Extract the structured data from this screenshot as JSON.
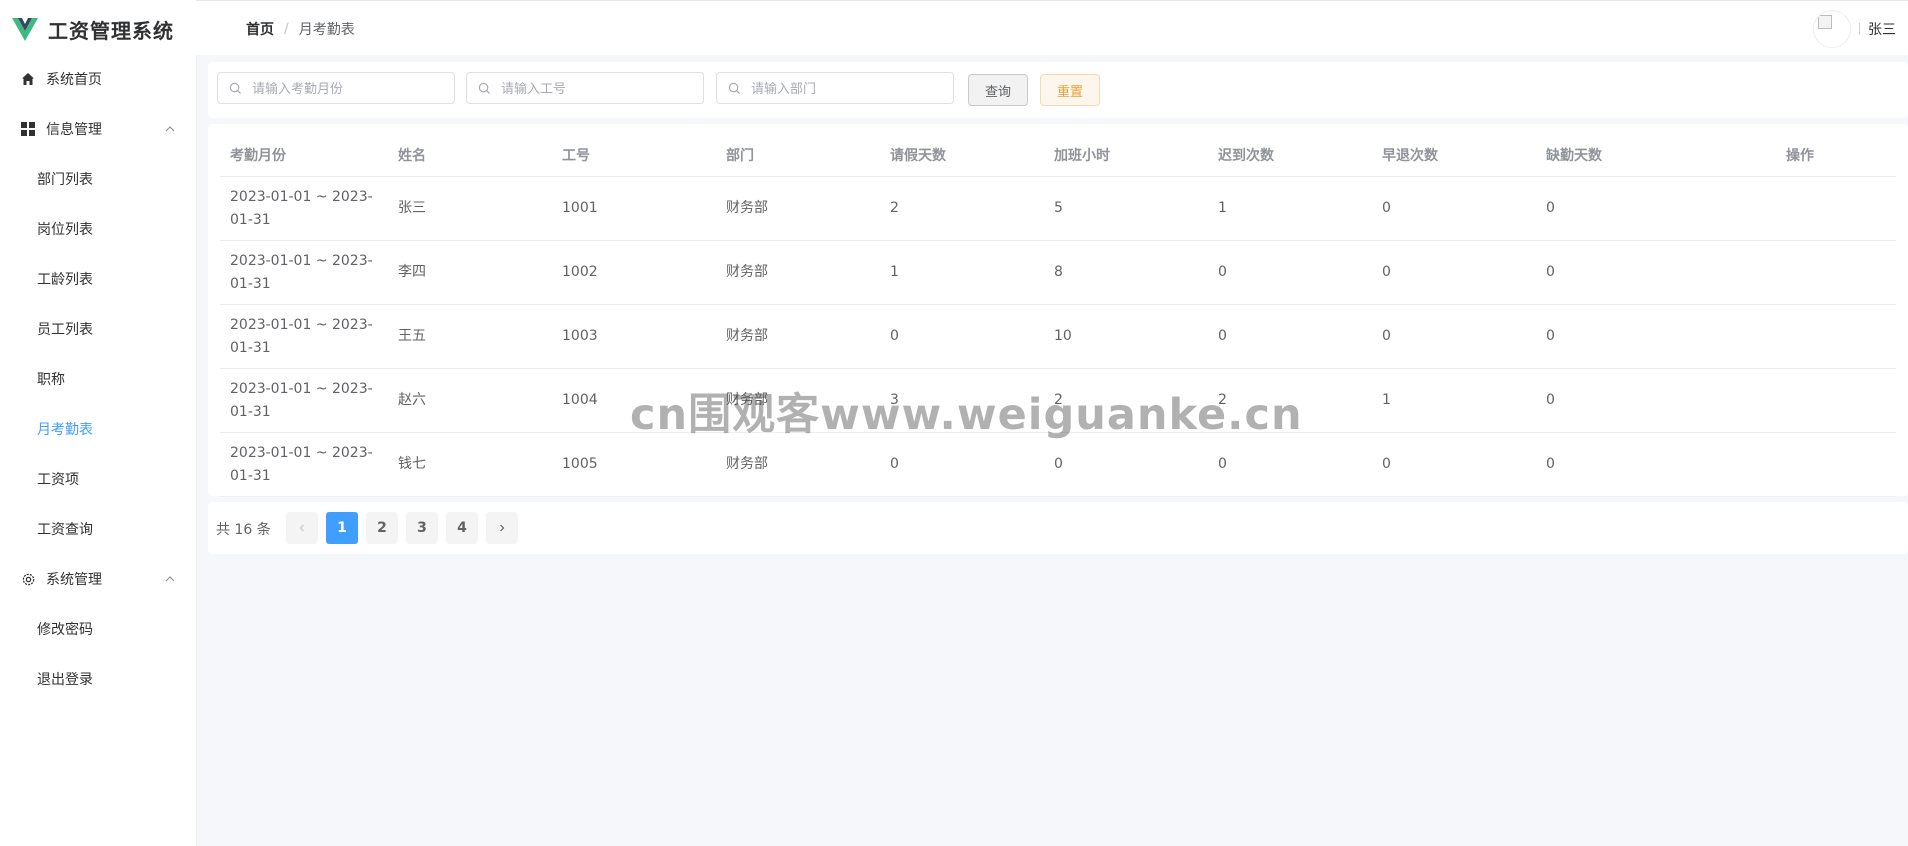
{
  "app": {
    "title": "工资管理系统",
    "brand_color": "#409eff",
    "logo_colors": [
      "#41b883",
      "#35495e"
    ]
  },
  "sidebar": {
    "items": [
      {
        "label": "系统首页",
        "icon": "home-icon"
      },
      {
        "label": "信息管理",
        "icon": "grid-icon",
        "expanded": true,
        "children": [
          "部门列表",
          "岗位列表",
          "工龄列表",
          "员工列表",
          "职称",
          "月考勤表",
          "工资项",
          "工资查询"
        ]
      },
      {
        "label": "系统管理",
        "icon": "gear-icon",
        "expanded": true,
        "children": [
          "修改密码",
          "退出登录"
        ]
      }
    ],
    "active": "月考勤表"
  },
  "header": {
    "breadcrumb": {
      "home": "首页",
      "separator": "/",
      "current": "月考勤表"
    },
    "user": {
      "name": "张三"
    }
  },
  "search": {
    "month_placeholder": "请输入考勤月份",
    "id_placeholder": "请输入工号",
    "dept_placeholder": "请输入部门",
    "query_label": "查询",
    "reset_label": "重置"
  },
  "table": {
    "columns": [
      "考勤月份",
      "姓名",
      "工号",
      "部门",
      "请假天数",
      "加班小时",
      "迟到次数",
      "早退次数",
      "缺勤天数",
      "操作"
    ],
    "rows": [
      [
        "2023-01-01 ~ 2023-01-31",
        "张三",
        "1001",
        "财务部",
        "2",
        "5",
        "1",
        "0",
        "0",
        ""
      ],
      [
        "2023-01-01 ~ 2023-01-31",
        "李四",
        "1002",
        "财务部",
        "1",
        "8",
        "0",
        "0",
        "0",
        ""
      ],
      [
        "2023-01-01 ~ 2023-01-31",
        "王五",
        "1003",
        "财务部",
        "0",
        "10",
        "0",
        "0",
        "0",
        ""
      ],
      [
        "2023-01-01 ~ 2023-01-31",
        "赵六",
        "1004",
        "财务部",
        "3",
        "2",
        "2",
        "1",
        "0",
        ""
      ],
      [
        "2023-01-01 ~ 2023-01-31",
        "钱七",
        "1005",
        "财务部",
        "0",
        "0",
        "0",
        "0",
        "0",
        ""
      ]
    ]
  },
  "pagination": {
    "total_label": "共 16 条",
    "pages": [
      "1",
      "2",
      "3",
      "4"
    ],
    "current": "1",
    "prev_icon": "chevron-left-icon",
    "next_icon": "chevron-right-icon"
  },
  "watermark": "cn围观客www.weiguanke.cn"
}
